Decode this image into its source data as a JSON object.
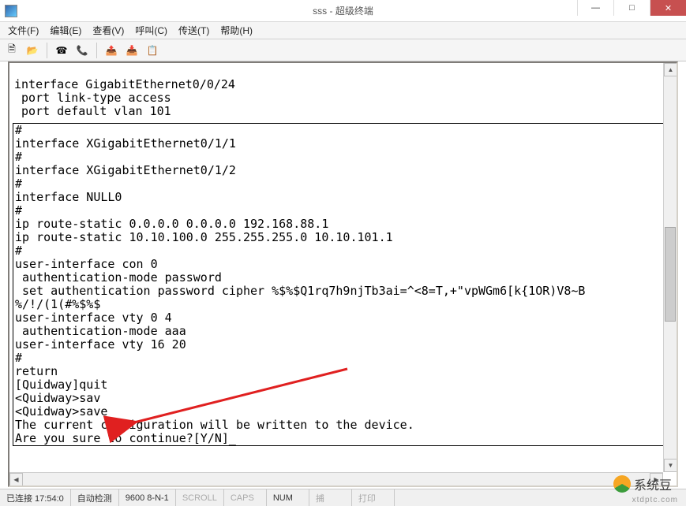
{
  "window": {
    "title": "sss - 超级终端",
    "app_icon": "terminal-icon"
  },
  "win_controls": {
    "minimize": "—",
    "maximize": "□",
    "close": "✕"
  },
  "menu": [
    "文件(F)",
    "编辑(E)",
    "查看(V)",
    "呼叫(C)",
    "传送(T)",
    "帮助(H)"
  ],
  "toolbar_icons": [
    "new-file-icon",
    "open-folder-icon",
    "connect-icon",
    "disconnect-icon",
    "send-icon",
    "receive-icon",
    "properties-icon"
  ],
  "terminal": {
    "top_block": [
      "interface GigabitEthernet0/0/24",
      " port link-type access",
      " port default vlan 101"
    ],
    "body": [
      "#",
      "interface XGigabitEthernet0/1/1",
      "#",
      "interface XGigabitEthernet0/1/2",
      "#",
      "interface NULL0",
      "#",
      "ip route-static 0.0.0.0 0.0.0.0 192.168.88.1",
      "ip route-static 10.10.100.0 255.255.255.0 10.10.101.1",
      "#",
      "user-interface con 0",
      " authentication-mode password",
      " set authentication password cipher %$%$Q1rq7h9njTb3ai=^<8=T,+\"vpWGm6[k{1OR)V8~B",
      "%/!/(1(#%$%$",
      "user-interface vty 0 4",
      " authentication-mode aaa",
      "user-interface vty 16 20",
      "#",
      "return",
      "[Quidway]quit",
      "<Quidway>sav",
      "<Quidway>save",
      "The current configuration will be written to the device.",
      "Are you sure to continue?[Y/N]_"
    ]
  },
  "statusbar": {
    "connection": "已连接 17:54:0",
    "detect": "自动检测",
    "line": "9600 8-N-1",
    "scroll": "SCROLL",
    "caps": "CAPS",
    "num": "NUM",
    "capture": "捕",
    "print": "打印"
  },
  "watermark": {
    "text": "系统豆",
    "url": "xtdptc.com"
  },
  "arrow": {
    "color": "#e02020"
  }
}
